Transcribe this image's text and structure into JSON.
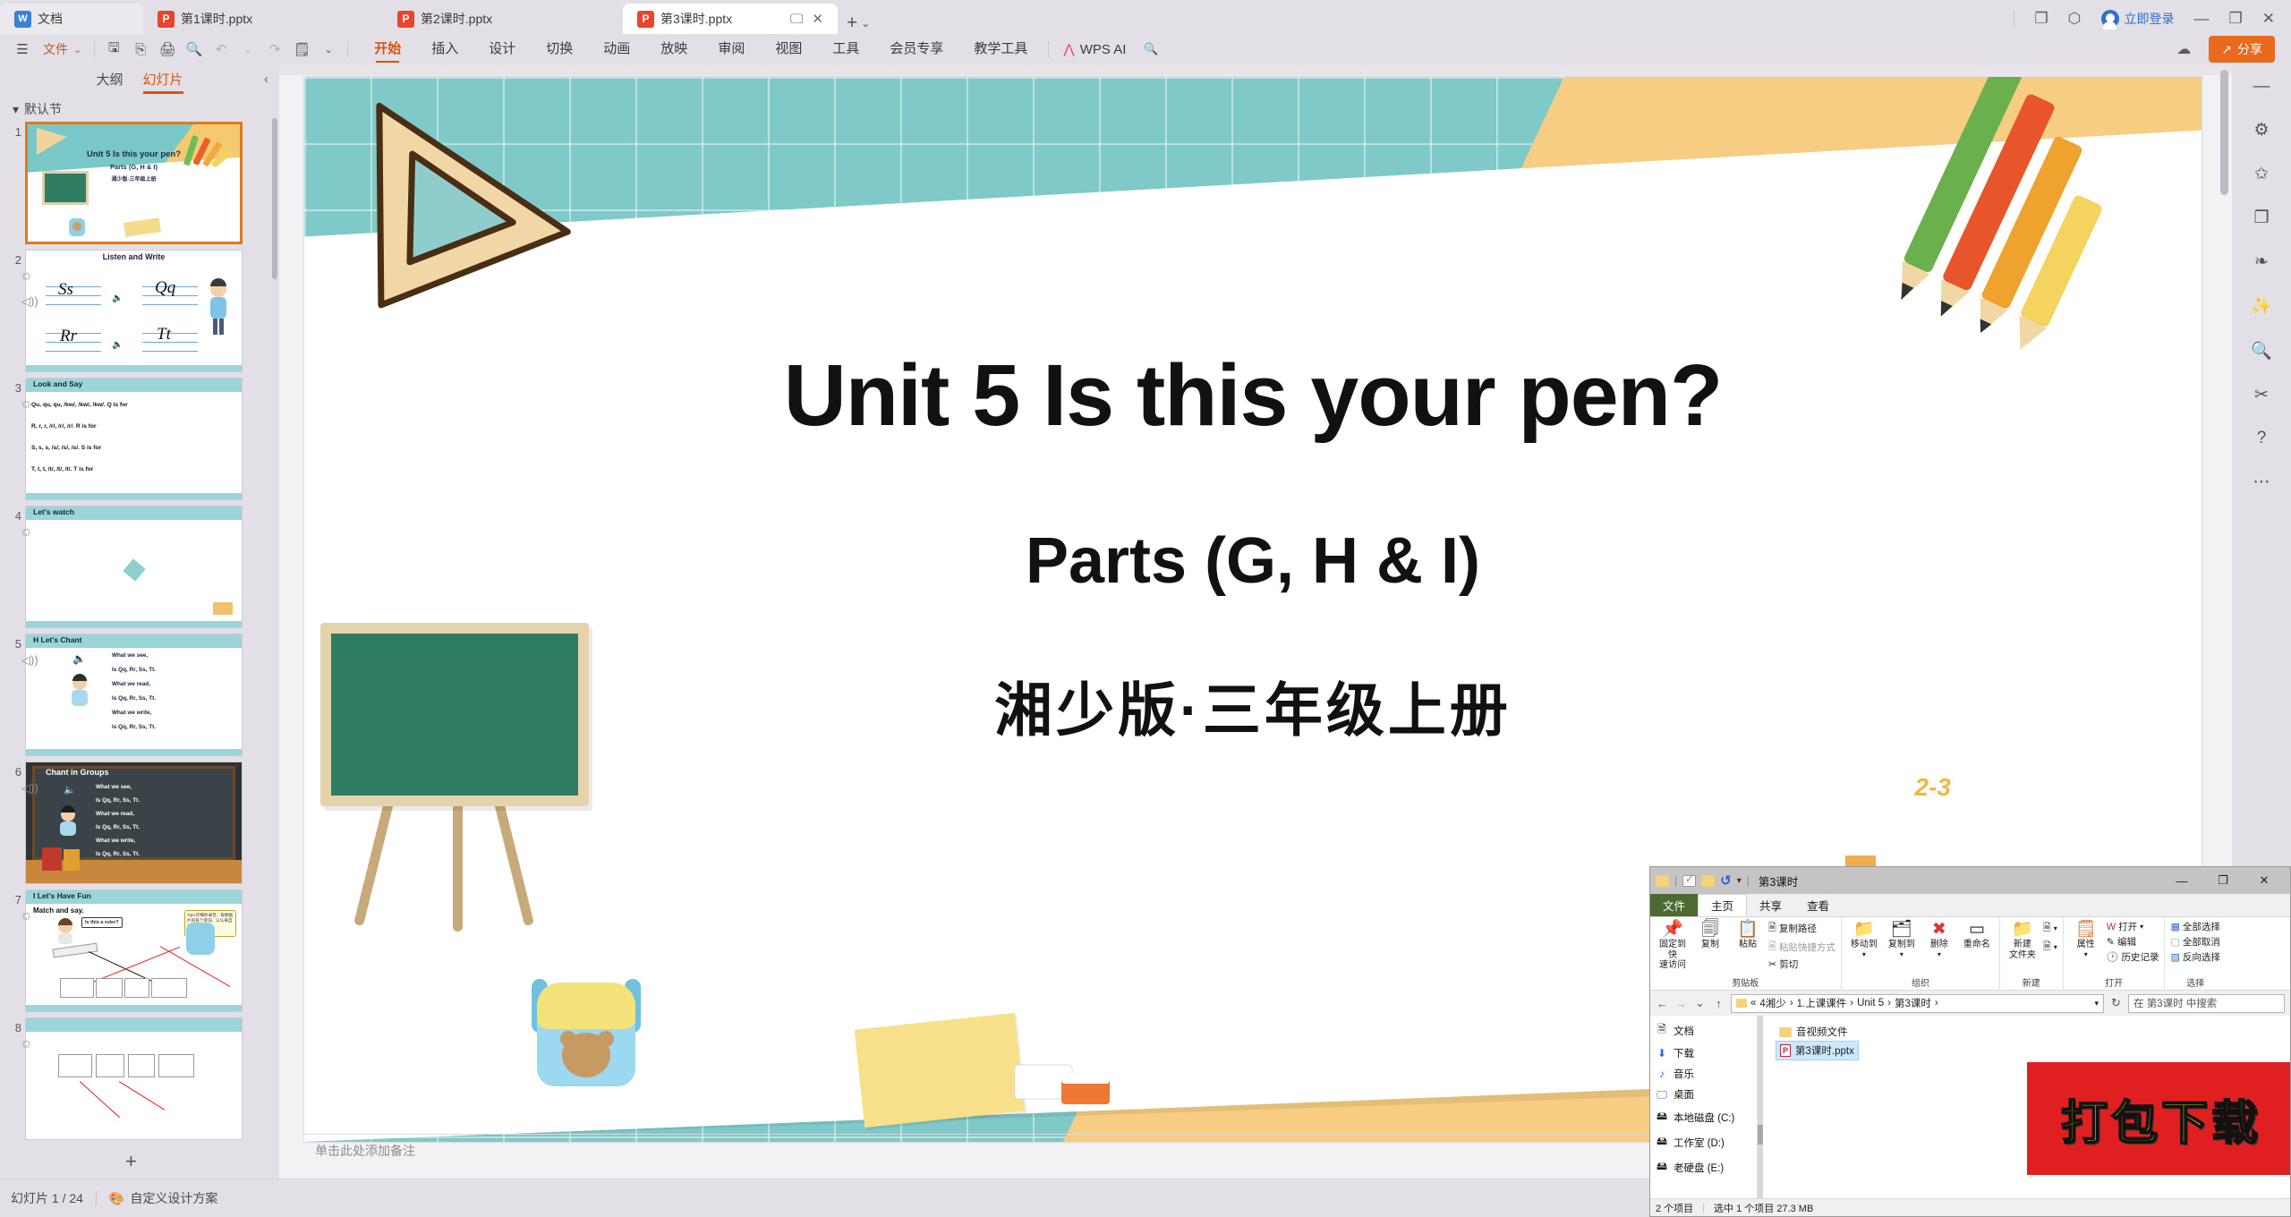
{
  "tabbar": {
    "home_tab": "文档",
    "tabs": [
      {
        "label": "第1课时.pptx",
        "active": false
      },
      {
        "label": "第2课时.pptx",
        "active": false
      },
      {
        "label": "第3课时.pptx",
        "active": true
      }
    ],
    "new_tab": "+",
    "login": "立即登录",
    "minimize": "—",
    "restore": "❐",
    "close": "✕"
  },
  "ribbon": {
    "file_menu": "文件",
    "quick_icons": [
      "save-icon",
      "save-as-icon",
      "print-icon",
      "print-preview-icon",
      "undo-icon",
      "redo-icon",
      "edit-mode-icon"
    ],
    "menus": [
      {
        "label": "开始",
        "active": true
      },
      {
        "label": "插入",
        "active": false
      },
      {
        "label": "设计",
        "active": false
      },
      {
        "label": "切换",
        "active": false
      },
      {
        "label": "动画",
        "active": false
      },
      {
        "label": "放映",
        "active": false
      },
      {
        "label": "审阅",
        "active": false
      },
      {
        "label": "视图",
        "active": false
      },
      {
        "label": "工具",
        "active": false
      },
      {
        "label": "会员专享",
        "active": false
      },
      {
        "label": "教学工具",
        "active": false
      }
    ],
    "wps_ai": "WPS AI",
    "share_label": "分享"
  },
  "left_panel": {
    "tab_outline": "大纲",
    "tab_slides": "幻灯片",
    "section": "默认节",
    "collapse": "‹",
    "add_slide": "+",
    "slides": [
      {
        "num": "1",
        "title": "Unit 5  Is this your pen?",
        "sub": "Parts (G, H & I)",
        "cn": "湘少版·三年级上册",
        "selected": true
      },
      {
        "num": "2",
        "title": "Listen and Write",
        "letters": [
          "Ss",
          "Qq",
          "Rr",
          "Tt"
        ],
        "selected": false
      },
      {
        "num": "3",
        "title": "Look and Say",
        "lines": [
          "Qu, qu, qu, /kw/, /kw/, /kw/. Q is for",
          "R, r, r, /r/, /r/, /r/. R is for",
          "S, s, s, /s/, /s/, /s/. S is for",
          "T, t, t, /t/, /t/, /t/. T is for"
        ],
        "selected": false
      },
      {
        "num": "4",
        "title": "Let's watch",
        "selected": false
      },
      {
        "num": "5",
        "title": "H  Let's Chant",
        "lines": [
          "What we see,",
          "Is Qq, Rr, Ss, Tt.",
          "What we read,",
          "Is Qq, Rr, Ss, Tt.",
          "What we write,",
          "Is Qq, Rr, Ss, Tt."
        ],
        "selected": false
      },
      {
        "num": "6",
        "title": "Chant in Groups",
        "lines": [
          "What we see,",
          "Is Qq, Rr, Ss, Tt.",
          "What we read,",
          "Is Qq, Rr, Ss, Tt.",
          "What we write,",
          "Is Qq, Rr, Ss, Tt."
        ],
        "selected": false
      },
      {
        "num": "7",
        "title": "I  Let's Have Fun",
        "sub": "Match and say.",
        "bubble": "Is this a ruler?",
        "tip": "Tips:仔细听录音，观察图片的各个单词、认认来自对词语",
        "selected": false
      },
      {
        "num": "8",
        "title": "",
        "selected": false
      }
    ]
  },
  "slide": {
    "title": "Unit 5  Is this your pen?",
    "subtitle": "Parts (G, H & I)",
    "publisher": "湘少版·三年级上册",
    "math_doodle": "2-3",
    "notes_placeholder": "单击此处添加备注"
  },
  "right_rail": {
    "icons": [
      "collapse-icon",
      "settings-sliders-icon",
      "animation-star-icon",
      "layout-icon",
      "beautify-icon",
      "magic-wand-icon",
      "preview-icon",
      "design-icon",
      "help-icon",
      "more-icon"
    ]
  },
  "status_bar": {
    "slide_counter": "幻灯片 1 / 24",
    "design_scheme": "自定义设计方案"
  },
  "explorer": {
    "title": "第3课时",
    "quick_icons": [
      "folder-icon",
      "properties-check-icon",
      "new-folder-icon",
      "undo-icon",
      "customize-dropdown-icon"
    ],
    "window_controls": {
      "minimize": "—",
      "maximize": "❐",
      "close": "✕"
    },
    "tabs": [
      {
        "label": "文件",
        "type": "file"
      },
      {
        "label": "主页",
        "type": "selected"
      },
      {
        "label": "共享",
        "type": "normal"
      },
      {
        "label": "查看",
        "type": "normal"
      }
    ],
    "ribbon_groups": [
      {
        "label": "剪贴板",
        "buttons": [
          {
            "label": "固定到快\n速访问",
            "icon": "pin-icon"
          },
          {
            "label": "复制",
            "icon": "copy-icon"
          },
          {
            "label": "粘贴",
            "icon": "paste-icon"
          }
        ],
        "small": [
          {
            "label": "复制路径",
            "icon": "copy-path-icon"
          },
          {
            "label": "粘贴快捷方式",
            "icon": "paste-shortcut-icon"
          },
          {
            "label": "剪切",
            "icon": "cut-icon"
          }
        ]
      },
      {
        "label": "组织",
        "buttons": [
          {
            "label": "移动到",
            "icon": "move-to-icon"
          },
          {
            "label": "复制到",
            "icon": "copy-to-icon"
          },
          {
            "label": "删除",
            "icon": "delete-icon"
          },
          {
            "label": "重命名",
            "icon": "rename-icon"
          }
        ],
        "small": []
      },
      {
        "label": "新建",
        "buttons": [
          {
            "label": "新建\n文件夹",
            "icon": "new-folder-icon"
          }
        ],
        "small": [
          {
            "label": "",
            "icon": "new-item-icon"
          },
          {
            "label": "",
            "icon": "easy-access-icon"
          }
        ]
      },
      {
        "label": "打开",
        "buttons": [
          {
            "label": "属性",
            "icon": "properties-icon"
          }
        ],
        "small": [
          {
            "label": "打开",
            "icon": "wps-open-icon"
          },
          {
            "label": "编辑",
            "icon": "edit-icon"
          },
          {
            "label": "历史记录",
            "icon": "history-icon"
          }
        ]
      },
      {
        "label": "选择",
        "buttons": [],
        "small": [
          {
            "label": "全部选择",
            "icon": "select-all-icon"
          },
          {
            "label": "全部取消",
            "icon": "select-none-icon"
          },
          {
            "label": "反向选择",
            "icon": "invert-selection-icon"
          }
        ]
      }
    ],
    "nav": {
      "back": "←",
      "forward": "→",
      "recent": "⌄",
      "up": "↑",
      "breadcrumb": [
        "4湘少",
        "1.上课课件",
        "Unit 5",
        "第3课时"
      ],
      "breadcrumb_prefix": "«",
      "refresh": "↻",
      "search_placeholder": "在 第3课时 中搜索"
    },
    "sidebar": [
      {
        "label": "文档",
        "icon": "documents-icon"
      },
      {
        "label": "下载",
        "icon": "downloads-icon"
      },
      {
        "label": "音乐",
        "icon": "music-icon"
      },
      {
        "label": "桌面",
        "icon": "desktop-icon"
      },
      {
        "label": "本地磁盘 (C:)",
        "icon": "drive-icon"
      },
      {
        "label": "工作室 (D:)",
        "icon": "drive-icon"
      },
      {
        "label": "老硬盘 (E:)",
        "icon": "drive-icon"
      }
    ],
    "files": [
      {
        "name": "音视频文件",
        "type": "folder",
        "selected": false
      },
      {
        "name": "第3课时.pptx",
        "type": "pptx",
        "selected": true
      }
    ],
    "stamp_text": "打包下载",
    "status": {
      "count": "2 个项目",
      "selection": "选中 1 个项目  27.3 MB"
    }
  }
}
